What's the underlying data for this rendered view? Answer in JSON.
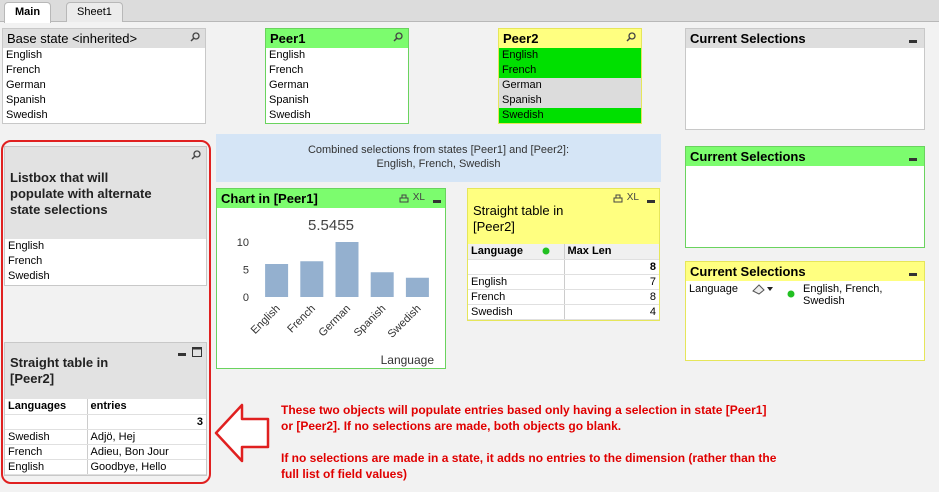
{
  "tabs": [
    "Main",
    "Sheet1"
  ],
  "languages": [
    "English",
    "French",
    "German",
    "Spanish",
    "Swedish"
  ],
  "base_state": {
    "title": "Base state <inherited>"
  },
  "peer1": {
    "title": "Peer1"
  },
  "peer2": {
    "title": "Peer2",
    "selected": [
      "English",
      "French",
      "Swedish"
    ]
  },
  "current_sel_1": {
    "title": "Current Selections"
  },
  "current_sel_2": {
    "title": "Current Selections"
  },
  "current_sel_3": {
    "title": "Current Selections",
    "field": "Language",
    "values": "English, French, Swedish",
    "values_line1": "English, French,",
    "values_line2": "Swedish"
  },
  "combined_text": {
    "line1": "Combined selections from states [Peer1] and [Peer2]:",
    "line2": "English, French, Swedish"
  },
  "listbox_alt": {
    "title_line1": "Listbox that will",
    "title_line2": "populate with alternate",
    "title_line3": "state selections",
    "items": [
      "English",
      "French",
      "Swedish"
    ]
  },
  "chart_peer1": {
    "title": "Chart in [Peer1]",
    "xl": "XL",
    "value_label": "5.5455",
    "xlabel": "Language"
  },
  "chart_data": {
    "type": "bar",
    "categories": [
      "English",
      "French",
      "German",
      "Spanish",
      "Swedish"
    ],
    "values": [
      6,
      6.5,
      10,
      4.5,
      3.5
    ],
    "ylim": [
      0,
      12
    ],
    "yticks": [
      0,
      5,
      10
    ],
    "xlabel": "Language",
    "title": "5.5455",
    "color": "#94b0cf"
  },
  "table_peer2": {
    "title_line1": "Straight table in",
    "title_line2": "[Peer2]",
    "xl": "XL",
    "col1": "Language",
    "col2": "Max Len",
    "total": "8",
    "rows": [
      {
        "lang": "English",
        "val": "7"
      },
      {
        "lang": "French",
        "val": "8"
      },
      {
        "lang": "Swedish",
        "val": "4"
      }
    ]
  },
  "table_alt": {
    "title_line1": "Straight table in",
    "title_line2": "[Peer2]",
    "col1": "Languages",
    "col2": "entries",
    "total": "3",
    "rows": [
      {
        "lang": "Swedish",
        "entry": "Adjö, Hej"
      },
      {
        "lang": "French",
        "entry": "Adieu, Bon Jour"
      },
      {
        "lang": "English",
        "entry": "Goodbye, Hello"
      }
    ]
  },
  "annotation": {
    "p1_line1": "These two objects will populate entries based only having a selection in state [Peer1]",
    "p1_line2": "or [Peer2].  If no selections are made, both objects go blank.",
    "p2_line1": "If no selections are made in a state, it adds no entries to the dimension (rather than the",
    "p2_line2": "full list of field values)"
  },
  "colors": {
    "green_caption": "#7cfc6e",
    "yellow_caption": "#ffff80",
    "selected": "#00e000",
    "annotation": "#e00000"
  }
}
